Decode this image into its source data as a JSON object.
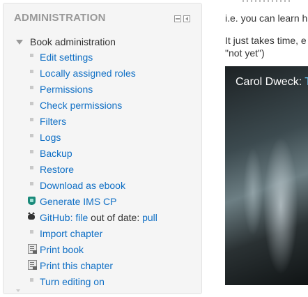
{
  "admin": {
    "title": "ADMINISTRATION",
    "root_label": "Book administration",
    "items": [
      {
        "label": "Edit settings",
        "icon": "bullet"
      },
      {
        "label": "Locally assigned roles",
        "icon": "bullet"
      },
      {
        "label": "Permissions",
        "icon": "bullet"
      },
      {
        "label": "Check permissions",
        "icon": "bullet"
      },
      {
        "label": "Filters",
        "icon": "bullet"
      },
      {
        "label": "Logs",
        "icon": "bullet"
      },
      {
        "label": "Backup",
        "icon": "bullet"
      },
      {
        "label": "Restore",
        "icon": "bullet"
      },
      {
        "label": "Download as ebook",
        "icon": "bullet"
      },
      {
        "label": "Generate IMS CP",
        "icon": "ims-package-icon"
      },
      {
        "label": "Import chapter",
        "icon": "bullet"
      },
      {
        "label": "Print book",
        "icon": "print-book-icon"
      },
      {
        "label": "Print this chapter",
        "icon": "print-chapter-icon"
      },
      {
        "label": "Turn editing on",
        "icon": "bullet"
      }
    ],
    "github": {
      "prefix": "GitHub:",
      "file": "file",
      "middle": "out of date:",
      "pull": "pull",
      "icon": "github-octocat-icon"
    }
  },
  "content": {
    "line1": "i.e. you can learn h",
    "line2": "It just takes time, e",
    "line3": "\"not yet\")",
    "video_title_main": "Carol Dweck: ",
    "video_title_accent": "T"
  },
  "colors": {
    "link": "#0f6fc5",
    "block_bg": "#f5f5f5",
    "header_text": "#999999"
  }
}
